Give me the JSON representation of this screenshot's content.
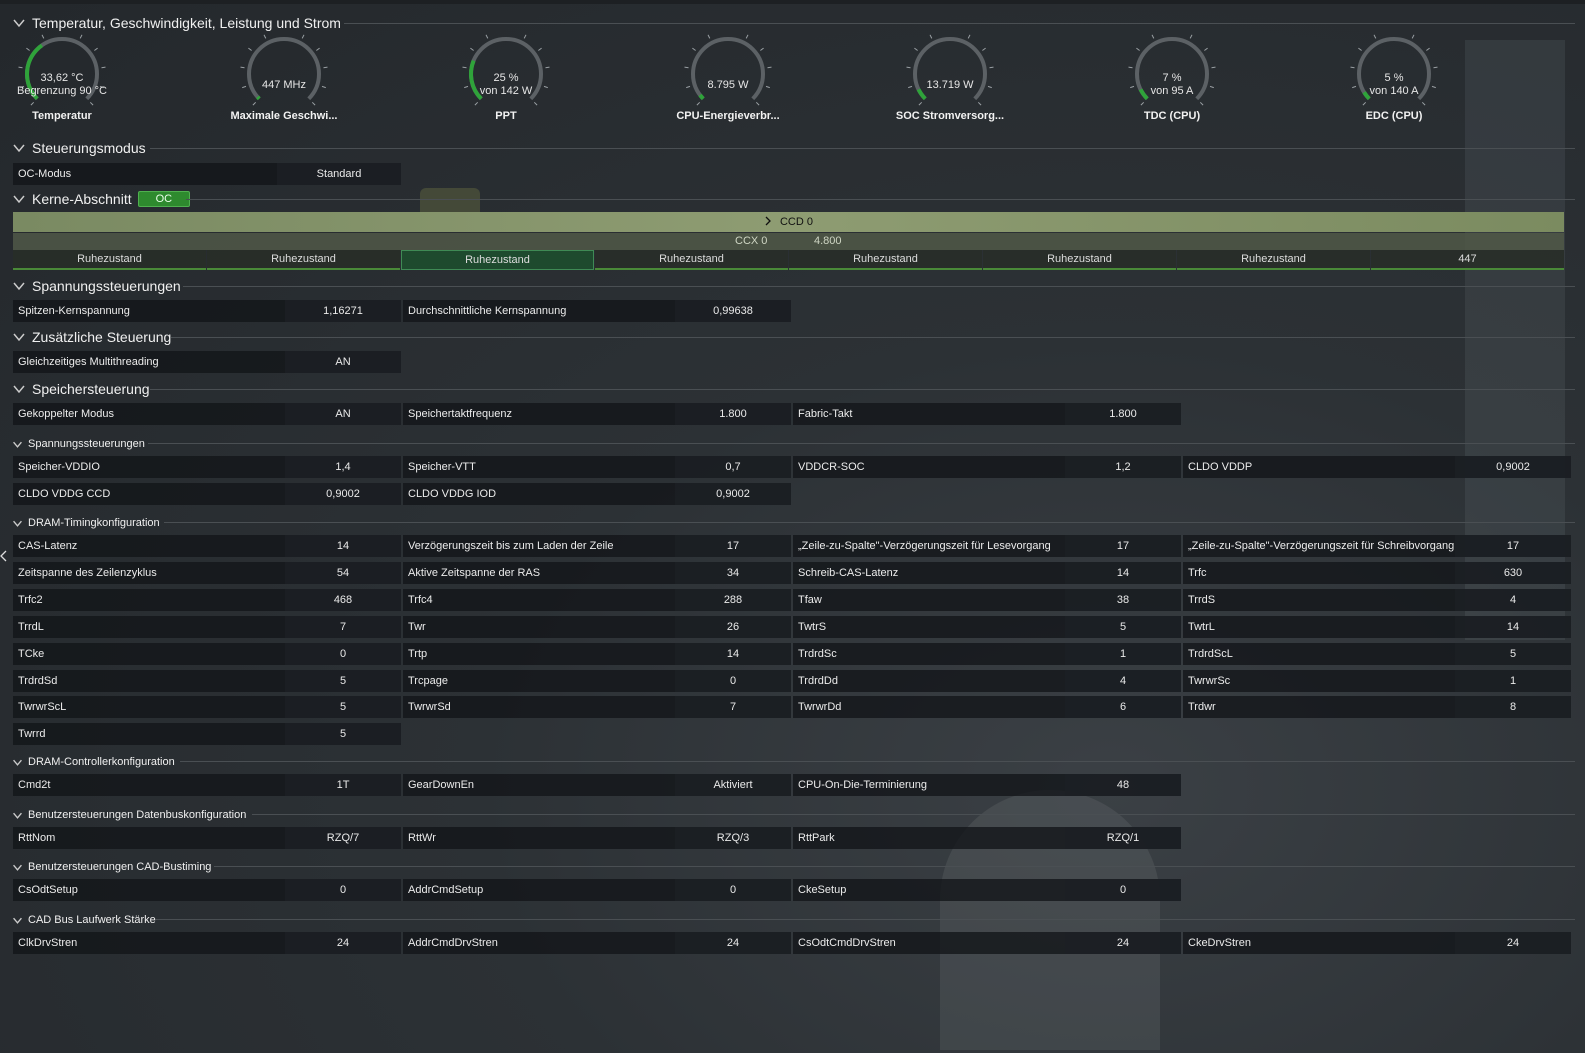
{
  "sections": {
    "temp": "Temperatur, Geschwindigkeit, Leistung und Strom",
    "control_mode": "Steuerungsmodus",
    "cores": "Kerne-Abschnitt",
    "cores_badge": "OC",
    "voltage": "Spannungssteuerungen",
    "additional": "Zusätzliche Steuerung",
    "memory": "Speichersteuerung",
    "mem_voltage": "Spannungssteuerungen",
    "dram_timing": "DRAM-Timingkonfiguration",
    "dram_controller": "DRAM-Controllerkonfiguration",
    "databus": "Benutzersteuerungen Datenbuskonfiguration",
    "cad_timing": "Benutzersteuerungen CAD-Bustiming",
    "cad_drive": "CAD Bus Laufwerk Stärke"
  },
  "gauges": [
    {
      "line1": "33,62 °C",
      "line2": "Begrenzung 90 °C",
      "caption": "Temperatur",
      "fill": 0.37
    },
    {
      "line1": "447  MHz",
      "line2": "",
      "caption": "Maximale Geschwi...",
      "fill": 0.0
    },
    {
      "line1": "25 %",
      "line2": "von 142 W",
      "caption": "PPT",
      "fill": 0.25
    },
    {
      "line1": "8.795 W",
      "line2": "",
      "caption": "CPU-Energieverbr...",
      "fill": 0.03
    },
    {
      "line1": "13.719 W",
      "line2": "",
      "caption": "SOC Stromversorg...",
      "fill": 0.07
    },
    {
      "line1": "7 %",
      "line2": "von 95 A",
      "caption": "TDC (CPU)",
      "fill": 0.07
    },
    {
      "line1": "5 %",
      "line2": "von 140 A",
      "caption": "EDC (CPU)",
      "fill": 0.05
    }
  ],
  "oc_mode": {
    "label": "OC-Modus",
    "value": "Standard"
  },
  "ccd": {
    "label": "CCD 0",
    "ccx": "CCX 0",
    "freq": "4.800"
  },
  "cores": [
    "Ruhezustand",
    "Ruhezustand",
    "Ruhezustand",
    "Ruhezustand",
    "Ruhezustand",
    "Ruhezustand",
    "Ruhezustand",
    "447"
  ],
  "voltage_rows": [
    [
      {
        "label": "Spitzen-Kernspannung",
        "value": "1,16271"
      },
      {
        "label": "Durchschnittliche Kernspannung",
        "value": "0,99638"
      }
    ]
  ],
  "additional_rows": [
    [
      {
        "label": "Gleichzeitiges Multithreading",
        "value": "AN"
      }
    ]
  ],
  "memory_rows": [
    [
      {
        "label": "Gekoppelter Modus",
        "value": "AN"
      },
      {
        "label": "Speichertaktfrequenz",
        "value": "1.800"
      },
      {
        "label": "Fabric-Takt",
        "value": "1.800"
      }
    ]
  ],
  "mem_voltage_rows": [
    [
      {
        "label": "Speicher-VDDIO",
        "value": "1,4"
      },
      {
        "label": "Speicher-VTT",
        "value": "0,7"
      },
      {
        "label": "VDDCR-SOC",
        "value": "1,2"
      },
      {
        "label": "CLDO VDDP",
        "value": "0,9002"
      }
    ],
    [
      {
        "label": "CLDO VDDG CCD",
        "value": "0,9002"
      },
      {
        "label": "CLDO VDDG IOD",
        "value": "0,9002"
      }
    ]
  ],
  "timing_rows": [
    [
      {
        "label": "CAS-Latenz",
        "value": "14"
      },
      {
        "label": "Verzögerungszeit bis zum Laden der Zeile",
        "value": "17"
      },
      {
        "label": "„Zeile-zu-Spalte\"-Verzögerungszeit für Lesevorgang",
        "value": "17"
      },
      {
        "label": "„Zeile-zu-Spalte\"-Verzögerungszeit für Schreibvorgang",
        "value": "17"
      }
    ],
    [
      {
        "label": "Zeitspanne des Zeilenzyklus",
        "value": "54"
      },
      {
        "label": "Aktive Zeitspanne der RAS",
        "value": "34"
      },
      {
        "label": "Schreib-CAS-Latenz",
        "value": "14"
      },
      {
        "label": "Trfc",
        "value": "630"
      }
    ],
    [
      {
        "label": "Trfc2",
        "value": "468"
      },
      {
        "label": "Trfc4",
        "value": "288"
      },
      {
        "label": "Tfaw",
        "value": "38"
      },
      {
        "label": "TrrdS",
        "value": "4"
      }
    ],
    [
      {
        "label": "TrrdL",
        "value": "7"
      },
      {
        "label": "Twr",
        "value": "26"
      },
      {
        "label": "TwtrS",
        "value": "5"
      },
      {
        "label": "TwtrL",
        "value": "14"
      }
    ],
    [
      {
        "label": "TCke",
        "value": "0"
      },
      {
        "label": "Trtp",
        "value": "14"
      },
      {
        "label": "TrdrdSc",
        "value": "1"
      },
      {
        "label": "TrdrdScL",
        "value": "5"
      }
    ],
    [
      {
        "label": "TrdrdSd",
        "value": "5"
      },
      {
        "label": "Trcpage",
        "value": "0"
      },
      {
        "label": "TrdrdDd",
        "value": "4"
      },
      {
        "label": "TwrwrSc",
        "value": "1"
      }
    ],
    [
      {
        "label": "TwrwrScL",
        "value": "5"
      },
      {
        "label": "TwrwrSd",
        "value": "7"
      },
      {
        "label": "TwrwrDd",
        "value": "6"
      },
      {
        "label": "Trdwr",
        "value": "8"
      }
    ],
    [
      {
        "label": "Twrrd",
        "value": "5"
      }
    ]
  ],
  "controller_rows": [
    [
      {
        "label": "Cmd2t",
        "value": "1T"
      },
      {
        "label": "GearDownEn",
        "value": "Aktiviert"
      },
      {
        "label": "CPU-On-Die-Terminierung",
        "value": "48"
      }
    ]
  ],
  "databus_rows": [
    [
      {
        "label": "RttNom",
        "value": "RZQ/7"
      },
      {
        "label": "RttWr",
        "value": "RZQ/3"
      },
      {
        "label": "RttPark",
        "value": "RZQ/1"
      }
    ]
  ],
  "cad_timing_rows": [
    [
      {
        "label": "CsOdtSetup",
        "value": "0"
      },
      {
        "label": "AddrCmdSetup",
        "value": "0"
      },
      {
        "label": "CkeSetup",
        "value": "0"
      }
    ]
  ],
  "cad_drive_rows": [
    [
      {
        "label": "ClkDrvStren",
        "value": "24"
      },
      {
        "label": "AddrCmdDrvStren",
        "value": "24"
      },
      {
        "label": "CsOdtCmdDrvStren",
        "value": "24"
      },
      {
        "label": "CkeDrvStren",
        "value": "24"
      }
    ]
  ]
}
